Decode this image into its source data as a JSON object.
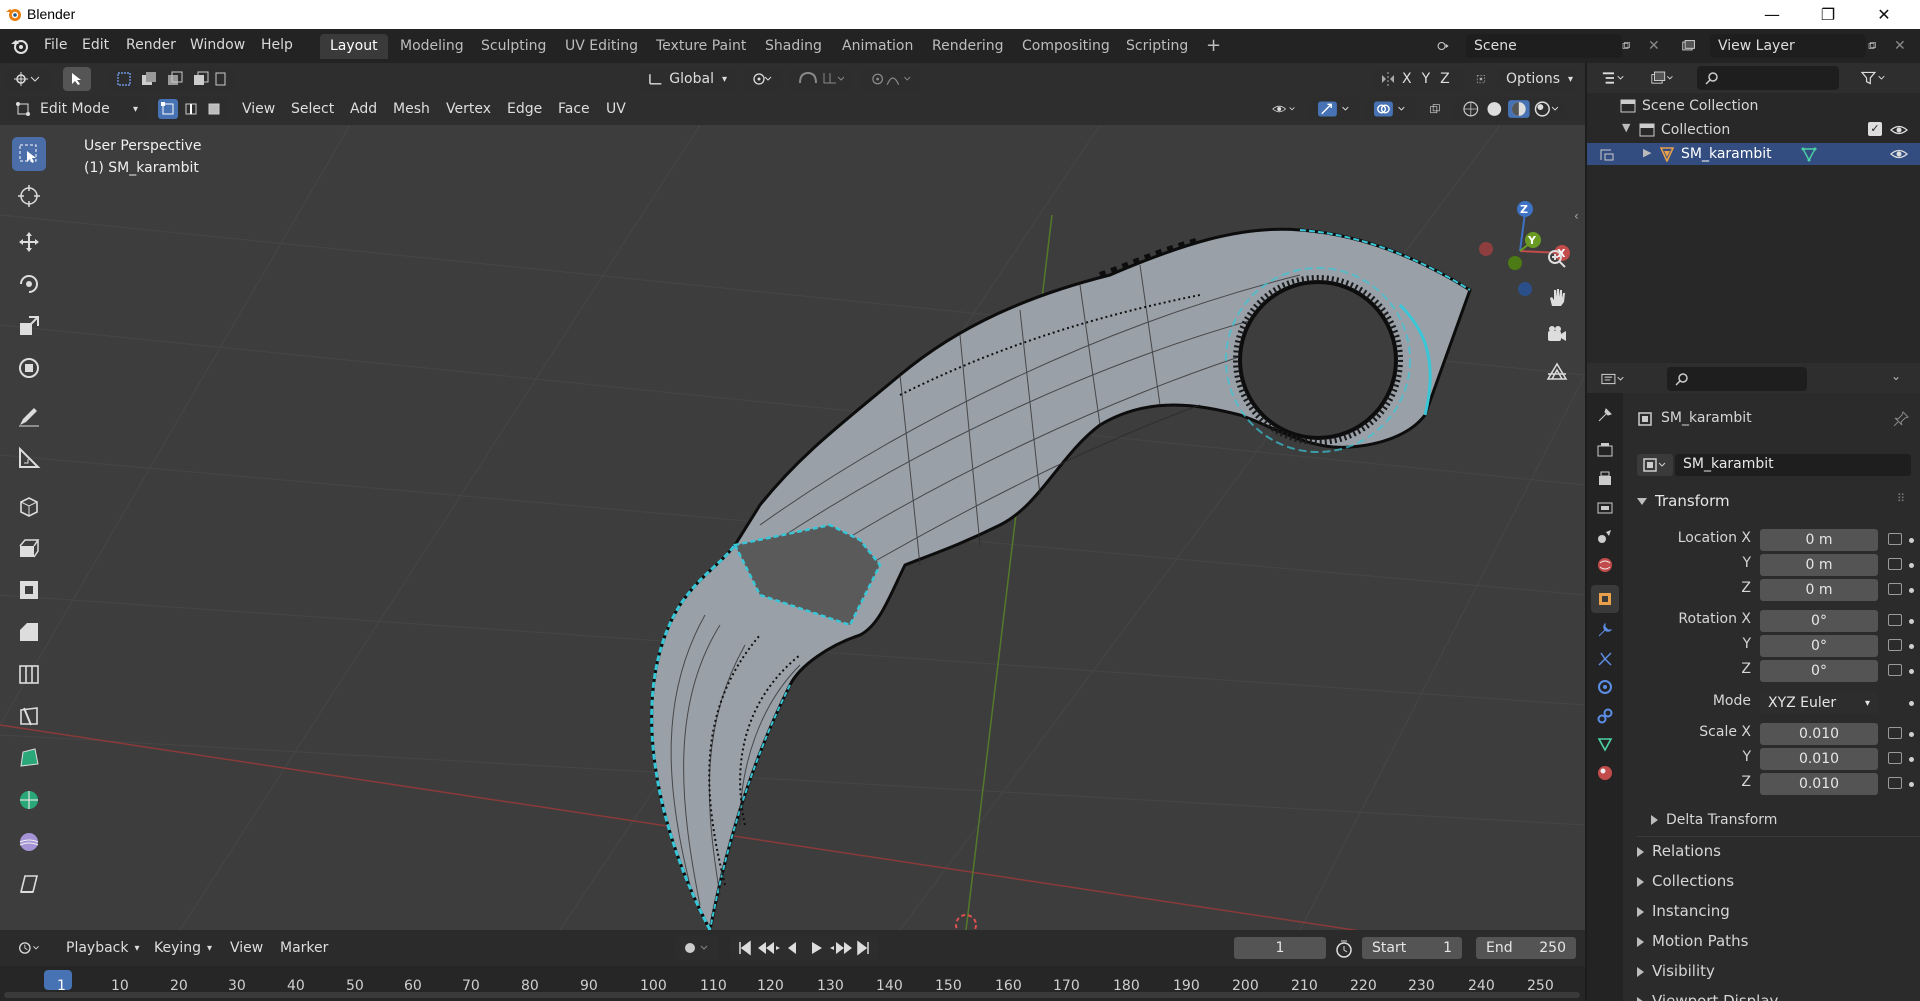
{
  "window": {
    "title": "Blender",
    "minimize": "—",
    "maximize": "❐",
    "close": "✕"
  },
  "menu": [
    "File",
    "Edit",
    "Render",
    "Window",
    "Help"
  ],
  "workspaces": [
    "Layout",
    "Modeling",
    "Sculpting",
    "UV Editing",
    "Texture Paint",
    "Shading",
    "Animation",
    "Rendering",
    "Compositing",
    "Scripting"
  ],
  "workspace_add": "+",
  "scene": {
    "label": "Scene",
    "view_layer": "View Layer"
  },
  "viewport": {
    "orientation": "Global",
    "options": "Options",
    "axes": [
      "X",
      "Y",
      "Z"
    ],
    "mode": "Edit Mode",
    "header_menus": [
      "View",
      "Select",
      "Add",
      "Mesh",
      "Vertex",
      "Edge",
      "Face",
      "UV"
    ],
    "perspective": "User Perspective",
    "object_info": "(1) SM_karambit",
    "gizmo_labels": {
      "x": "X",
      "y": "Y",
      "z": "Z"
    }
  },
  "outliner": {
    "scene_collection": "Scene Collection",
    "collection": "Collection",
    "object": "SM_karambit"
  },
  "properties": {
    "object_name": "SM_karambit",
    "datablock": "SM_karambit",
    "transform_label": "Transform",
    "location_label": "Location X",
    "rotation_label": "Rotation X",
    "scale_label": "Scale X",
    "y_label": "Y",
    "z_label": "Z",
    "location": [
      "0 m",
      "0 m",
      "0 m"
    ],
    "rotation": [
      "0°",
      "0°",
      "0°"
    ],
    "mode_label": "Mode",
    "mode_value": "XYZ Euler",
    "scale": [
      "0.010",
      "0.010",
      "0.010"
    ],
    "delta_transform": "Delta Transform",
    "sections": [
      "Relations",
      "Collections",
      "Instancing",
      "Motion Paths",
      "Visibility",
      "Viewport Display"
    ]
  },
  "timeline": {
    "menus": [
      "Playback",
      "Keying",
      "View",
      "Marker"
    ],
    "current_frame": "1",
    "start_label": "Start",
    "start": "1",
    "end_label": "End",
    "end": "250",
    "ruler": [
      "1",
      "10",
      "20",
      "30",
      "40",
      "50",
      "60",
      "70",
      "80",
      "90",
      "100",
      "110",
      "120",
      "130",
      "140",
      "150",
      "160",
      "170",
      "180",
      "190",
      "200",
      "210",
      "220",
      "230",
      "240",
      "250"
    ]
  },
  "colors": {
    "accent": "#4772b3",
    "viewport_bg": "#3d3d3d",
    "mesh_edge": "#39c6d6",
    "x_axis": "#c24b4b",
    "y_axis": "#6a9a23"
  }
}
